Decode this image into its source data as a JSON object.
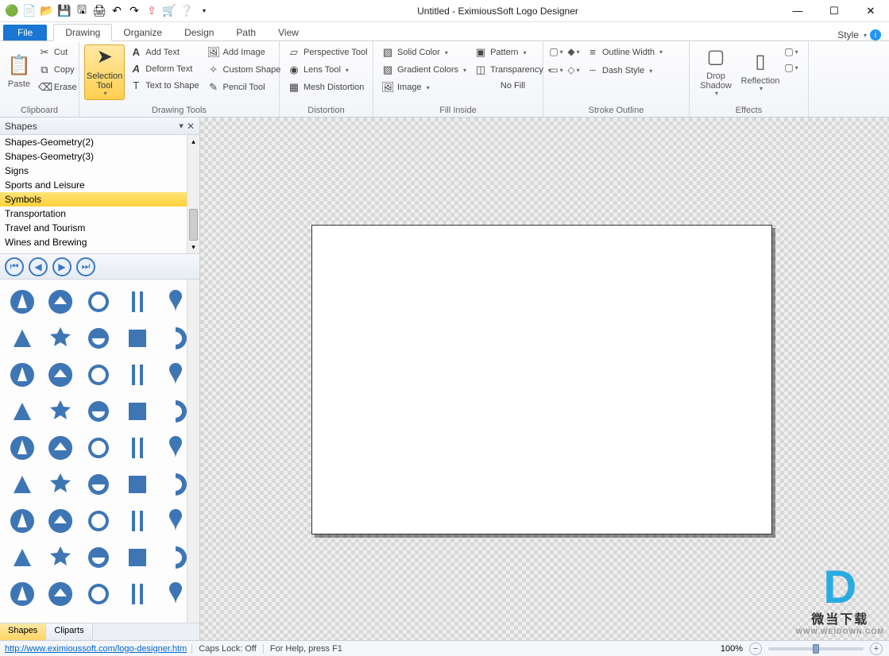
{
  "title": "Untitled - EximiousSoft Logo Designer",
  "quick_access": [
    "logo",
    "new",
    "open",
    "save",
    "save-all",
    "print",
    "undo",
    "redo",
    "export",
    "cart",
    "help"
  ],
  "window_controls": {
    "min": "—",
    "max": "☐",
    "close": "✕"
  },
  "tabs": {
    "file": "File",
    "items": [
      "Drawing",
      "Organize",
      "Design",
      "Path",
      "View"
    ],
    "active": 0,
    "style": "Style"
  },
  "ribbon": {
    "clipboard": {
      "label": "Clipboard",
      "paste": "Paste",
      "cut": "Cut",
      "copy": "Copy",
      "erase": "Erase"
    },
    "drawing_tools": {
      "label": "Drawing Tools",
      "selection": "Selection Tool",
      "col1": [
        "Add Text",
        "Deform Text",
        "Text to Shape"
      ],
      "col2": [
        "Add Image",
        "Custom Shape",
        "Pencil Tool"
      ]
    },
    "distortion": {
      "label": "Distortion",
      "items": [
        "Perspective Tool",
        "Lens Tool",
        "Mesh Distortion"
      ]
    },
    "fill_inside": {
      "label": "Fill Inside",
      "col1": [
        "Solid Color",
        "Gradient Colors",
        "Image"
      ],
      "col2": [
        "Pattern",
        "Transparency",
        "No Fill"
      ]
    },
    "stroke_outline": {
      "label": "Stroke Outline",
      "row1": [
        "Outline Width",
        "Dash Style"
      ]
    },
    "effects": {
      "label": "Effects",
      "drop_shadow": "Drop Shadow",
      "reflection": "Reflection"
    }
  },
  "shapes_panel": {
    "title": "Shapes",
    "categories": [
      "Shapes-Geometry(2)",
      "Shapes-Geometry(3)",
      "Signs",
      "Sports and Leisure",
      "Symbols",
      "Transportation",
      "Travel and Tourism",
      "Wines and Brewing"
    ],
    "selected": "Symbols",
    "tabs": [
      "Shapes",
      "Cliparts"
    ],
    "active_tab": 0
  },
  "status": {
    "url": "http://www.eximioussoft.com/logo-designer.htm",
    "caps": "Caps Lock: Off",
    "help": "For Help, press F1",
    "zoom": "100%"
  },
  "watermark": {
    "brand": "微当下载",
    "site": "WWW.WEIDOWN.COM"
  }
}
